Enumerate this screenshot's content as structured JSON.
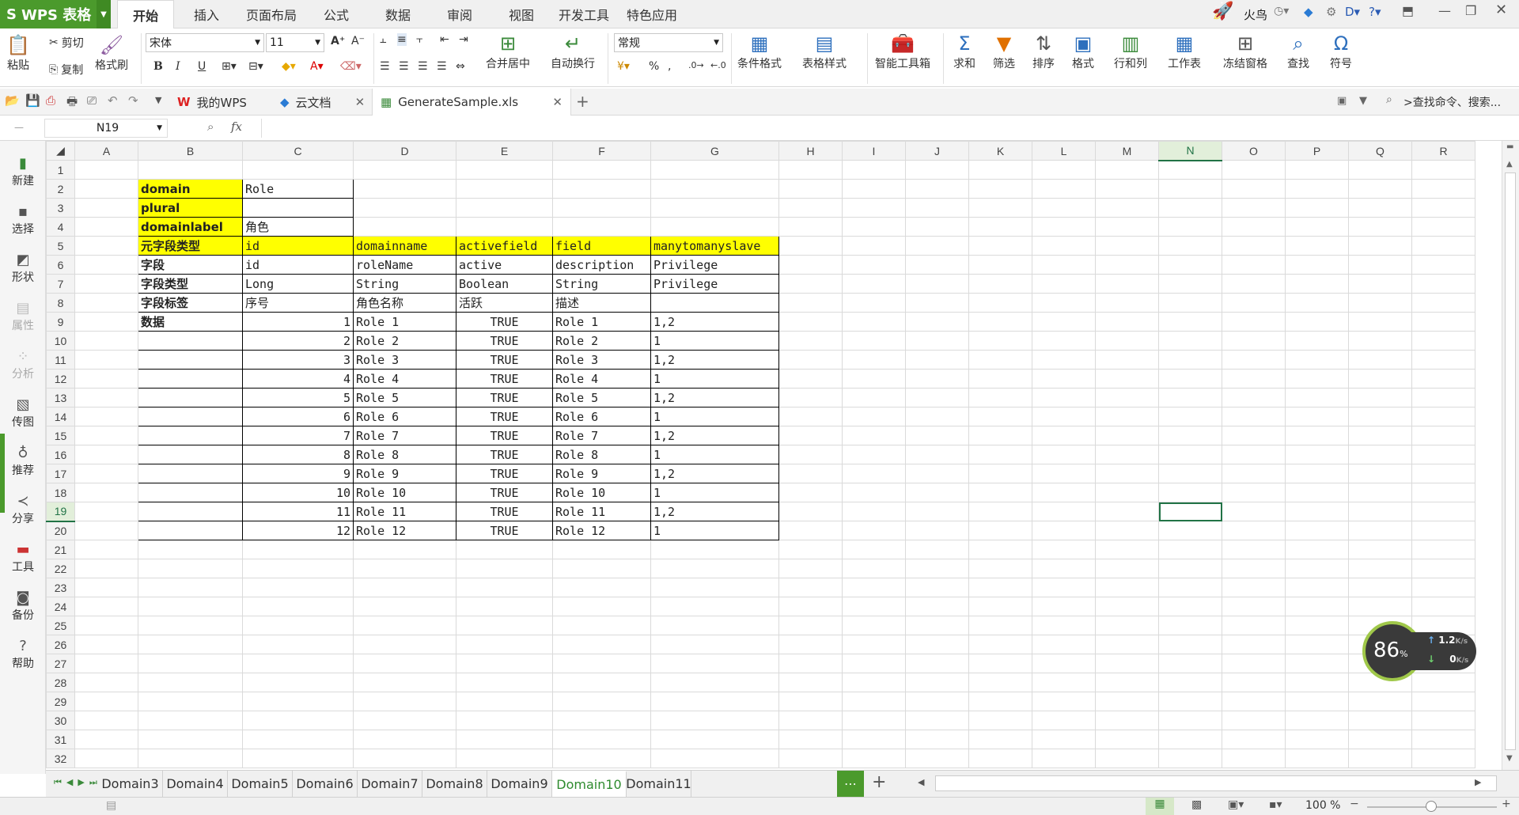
{
  "app": {
    "name": "WPS 表格",
    "user": "火鸟"
  },
  "menu_tabs": [
    "开始",
    "插入",
    "页面布局",
    "公式",
    "数据",
    "审阅",
    "视图",
    "开发工具",
    "特色应用"
  ],
  "ribbon": {
    "paste": "粘贴",
    "cut": "剪切",
    "copy": "复制",
    "format_painter": "格式刷",
    "font_name": "宋体",
    "font_size": "11",
    "merge_center": "合并居中",
    "wrap_text": "自动换行",
    "number_format": "常规",
    "percent": "%",
    "cond_format": "条件格式",
    "table_style": "表格样式",
    "smart_toolbox": "智能工具箱",
    "sum": "求和",
    "filter": "筛选",
    "sort": "排序",
    "format": "格式",
    "row_col": "行和列",
    "worksheet": "工作表",
    "freeze": "冻结窗格",
    "find": "查找",
    "symbol": "符号"
  },
  "doc_tabs": {
    "my_wps": "我的WPS",
    "cloud": "云文档",
    "file": "GenerateSample.xls"
  },
  "search_cmd": "查找命令、搜索...",
  "name_box": "N19",
  "fx_label": "fx",
  "sidebar": [
    "新建",
    "选择",
    "形状",
    "属性",
    "分析",
    "传图",
    "推荐",
    "分享",
    "工具",
    "备份",
    "帮助"
  ],
  "columns": [
    "A",
    "B",
    "C",
    "D",
    "E",
    "F",
    "G",
    "H",
    "I",
    "J",
    "K",
    "L",
    "M",
    "N",
    "O",
    "P",
    "Q",
    "R"
  ],
  "rows": [
    "1",
    "2",
    "3",
    "4",
    "5",
    "6",
    "7",
    "8",
    "9",
    "10",
    "11",
    "12",
    "13",
    "14",
    "15",
    "16",
    "17",
    "18",
    "19",
    "20",
    "21",
    "22",
    "23",
    "24",
    "25",
    "26",
    "27",
    "28",
    "29",
    "30",
    "31",
    "32"
  ],
  "cells": {
    "header": [
      [
        "domain",
        "Role"
      ],
      [
        "plural",
        ""
      ],
      [
        "domainlabel",
        "角色"
      ]
    ],
    "meta": [
      [
        "元字段类型",
        "id",
        "domainname",
        "activefield",
        "field",
        "manytomanyslave"
      ],
      [
        "字段",
        "id",
        "roleName",
        "active",
        "description",
        "Privilege"
      ],
      [
        "字段类型",
        "Long",
        "String",
        "Boolean",
        "String",
        "Privilege"
      ],
      [
        "字段标签",
        "序号",
        "角色名称",
        "活跃",
        "描述",
        ""
      ]
    ],
    "data_label": "数据",
    "data": [
      [
        "1",
        "Role 1",
        "TRUE",
        "Role 1",
        "1,2"
      ],
      [
        "2",
        "Role 2",
        "TRUE",
        "Role 2",
        "1"
      ],
      [
        "3",
        "Role 3",
        "TRUE",
        "Role 3",
        "1,2"
      ],
      [
        "4",
        "Role 4",
        "TRUE",
        "Role 4",
        "1"
      ],
      [
        "5",
        "Role 5",
        "TRUE",
        "Role 5",
        "1,2"
      ],
      [
        "6",
        "Role 6",
        "TRUE",
        "Role 6",
        "1"
      ],
      [
        "7",
        "Role 7",
        "TRUE",
        "Role 7",
        "1,2"
      ],
      [
        "8",
        "Role 8",
        "TRUE",
        "Role 8",
        "1"
      ],
      [
        "9",
        "Role 9",
        "TRUE",
        "Role 9",
        "1,2"
      ],
      [
        "10",
        "Role 10",
        "TRUE",
        "Role 10",
        "1"
      ],
      [
        "11",
        "Role 11",
        "TRUE",
        "Role 11",
        "1,2"
      ],
      [
        "12",
        "Role 12",
        "TRUE",
        "Role 12",
        "1"
      ]
    ]
  },
  "sheet_tabs": [
    "Domain3",
    "Domain4",
    "Domain5",
    "Domain6",
    "Domain7",
    "Domain8",
    "Domain9",
    "Domain10",
    "Domain11"
  ],
  "active_sheet": "Domain10",
  "zoom": "100 %",
  "speed_widget": {
    "percent": "86",
    "unit": "%",
    "up": "1.2",
    "down": "0",
    "rate_unit": "K/s"
  },
  "colors": {
    "brand": "#4b9a2c",
    "highlight": "#ffff00",
    "select": "#217346"
  }
}
